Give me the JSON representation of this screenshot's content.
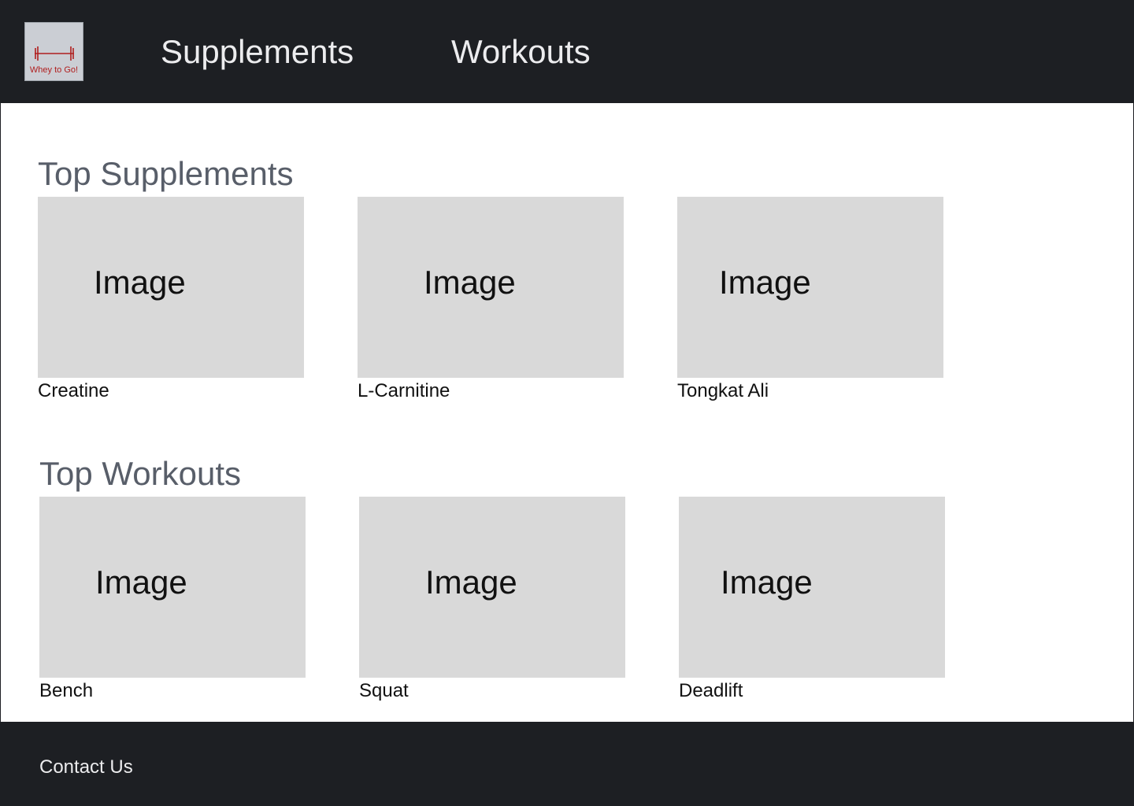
{
  "header": {
    "logo_text": "Whey to Go!",
    "logo_icon": "barbell-icon",
    "nav": [
      {
        "label": "Supplements"
      },
      {
        "label": "Workouts"
      }
    ]
  },
  "sections": {
    "supplements": {
      "title": "Top Supplements",
      "cards": [
        {
          "image_placeholder": "Image",
          "caption": "Creatine"
        },
        {
          "image_placeholder": "Image",
          "caption": "L-Carnitine"
        },
        {
          "image_placeholder": "Image",
          "caption": "Tongkat Ali"
        }
      ]
    },
    "workouts": {
      "title": "Top Workouts",
      "cards": [
        {
          "image_placeholder": "Image",
          "caption": "Bench"
        },
        {
          "image_placeholder": "Image",
          "caption": "Squat"
        },
        {
          "image_placeholder": "Image",
          "caption": "Deadlift"
        }
      ]
    }
  },
  "footer": {
    "contact_label": "Contact Us"
  },
  "colors": {
    "bar_background": "#1d1f23",
    "placeholder_gray": "#d9d9d9",
    "section_title": "#585e69",
    "logo_accent": "#b01e1e"
  }
}
